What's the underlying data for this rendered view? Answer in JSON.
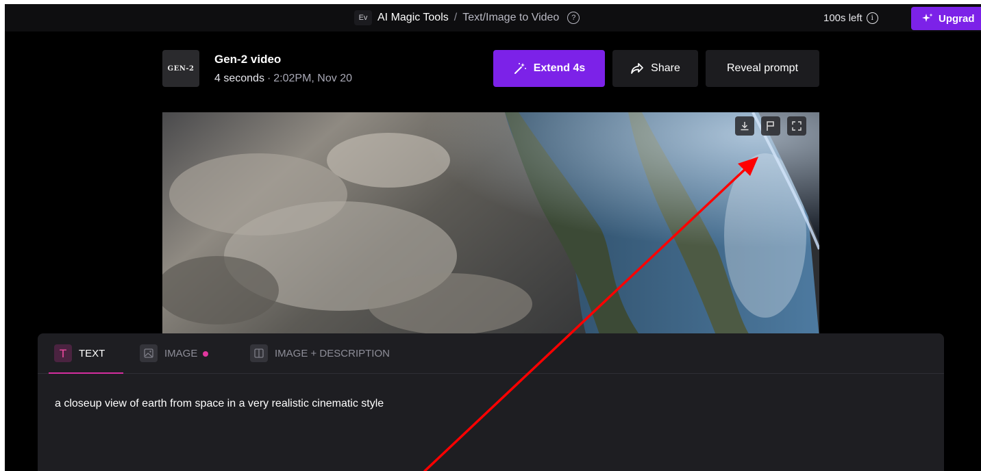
{
  "topbar": {
    "workspace_badge": "Ev",
    "breadcrumb_root": "AI Magic Tools",
    "breadcrumb_sep": "/",
    "breadcrumb_current": "Text/Image to Video",
    "help_icon": "question-circle-icon",
    "credits": "100s left",
    "info_icon": "info-circle-icon",
    "upgrade_label": "Upgrad"
  },
  "generation": {
    "thumb_label": "GEN-2",
    "title": "Gen-2 video",
    "duration": "4 seconds",
    "separator": "·",
    "timestamp": "2:02PM, Nov 20"
  },
  "actions": {
    "extend_label": "Extend 4s",
    "share_label": "Share",
    "reveal_label": "Reveal prompt"
  },
  "video_controls": {
    "download_icon": "download-icon",
    "flag_icon": "flag-icon",
    "fullscreen_icon": "expand-icon"
  },
  "prompt_panel": {
    "tabs": [
      {
        "label": "TEXT",
        "icon": "text-t-icon",
        "active": true
      },
      {
        "label": "IMAGE",
        "icon": "image-icon",
        "active": false
      },
      {
        "label": "IMAGE + DESCRIPTION",
        "icon": "split-panel-icon",
        "active": false
      }
    ],
    "prompt_text": "a closeup view of earth from space in a very realistic cinematic style"
  },
  "colors": {
    "accent_purple": "#7c22e8",
    "accent_pink": "#e0379e",
    "background": "#000000",
    "panel": "#1e1e22",
    "annotation_arrow": "#ff0000"
  }
}
